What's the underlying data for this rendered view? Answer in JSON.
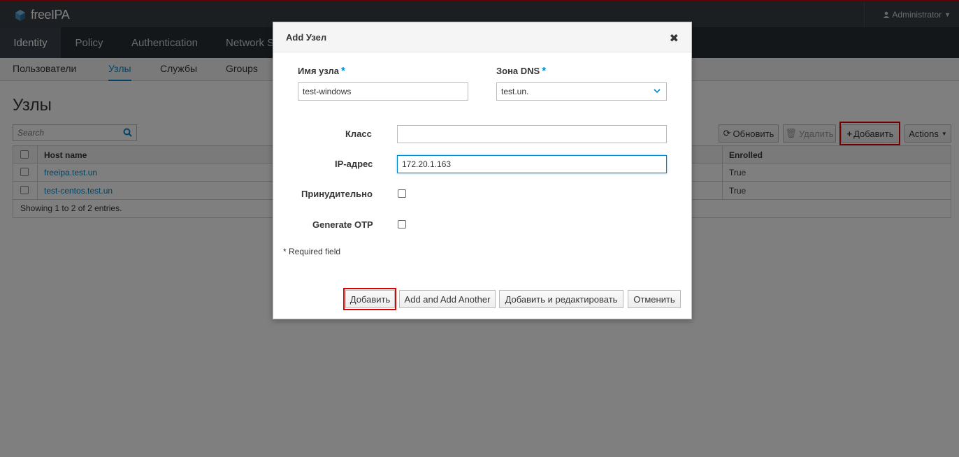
{
  "header": {
    "brand": "freeIPA",
    "user": "Administrator"
  },
  "nav": {
    "items": [
      {
        "label": "Identity"
      },
      {
        "label": "Policy"
      },
      {
        "label": "Authentication"
      },
      {
        "label": "Network Se"
      }
    ]
  },
  "subnav": {
    "items": [
      {
        "label": "Пользователи"
      },
      {
        "label": "Узлы"
      },
      {
        "label": "Службы"
      },
      {
        "label": "Groups"
      }
    ]
  },
  "page": {
    "title": "Узлы",
    "search_placeholder": "Search",
    "toolbar": {
      "refresh": "Обновить",
      "delete": "Удалить",
      "add": "Добавить",
      "actions": "Actions"
    },
    "table": {
      "columns": [
        "Host name",
        "Enrolled"
      ],
      "rows": [
        {
          "host": "freeipa.test.un",
          "enrolled": "True"
        },
        {
          "host": "test-centos.test.un",
          "enrolled": "True"
        }
      ],
      "footer": "Showing 1 to 2 of 2 entries."
    }
  },
  "dialog": {
    "title": "Add Узел",
    "hostname_label": "Имя узла",
    "hostname_value": "test-windows",
    "dnszone_label": "Зона DNS",
    "dnszone_value": "test.un.",
    "class_label": "Класс",
    "class_value": "",
    "ip_label": "IP-адрес",
    "ip_value": "172.20.1.163",
    "force_label": "Принудительно",
    "otp_label": "Generate OTP",
    "required_star": "*",
    "required_note": "* Required field",
    "buttons": {
      "add": "Добавить",
      "add_another": "Add and Add Another",
      "add_edit": "Добавить и редактировать",
      "cancel": "Отменить"
    }
  },
  "colors": {
    "accent": "#0088ce",
    "highlight": "#e00000",
    "topbar": "#393f44",
    "nav": "#292e34"
  }
}
